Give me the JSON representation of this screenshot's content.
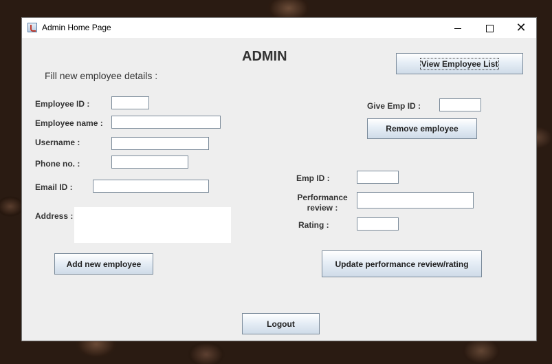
{
  "window": {
    "title": "Admin Home Page",
    "controls": {
      "minimize": "",
      "maximize": "",
      "close": "✕"
    }
  },
  "header": {
    "title": "ADMIN",
    "subtitle": "Fill new employee details :"
  },
  "add_form": {
    "employee_id_label": "Employee ID :",
    "employee_name_label": "Employee name :",
    "username_label": "Username :",
    "phone_label": "Phone no. :",
    "email_label": "Email ID :",
    "address_label": "Address :",
    "employee_id_value": "",
    "employee_name_value": "",
    "username_value": "",
    "phone_value": "",
    "email_value": "",
    "address_value": "",
    "add_button": "Add new employee"
  },
  "view_list_button": "View Employee List",
  "remove_section": {
    "give_emp_id_label": "Give Emp ID :",
    "give_emp_id_value": "",
    "remove_button": "Remove employee"
  },
  "review_section": {
    "emp_id_label": "Emp ID :",
    "performance_label_line1": "Performance",
    "performance_label_line2": "review :",
    "rating_label": "Rating :",
    "emp_id_value": "",
    "performance_value": "",
    "rating_value": "",
    "update_button": "Update performance review/rating"
  },
  "logout_button": "Logout"
}
